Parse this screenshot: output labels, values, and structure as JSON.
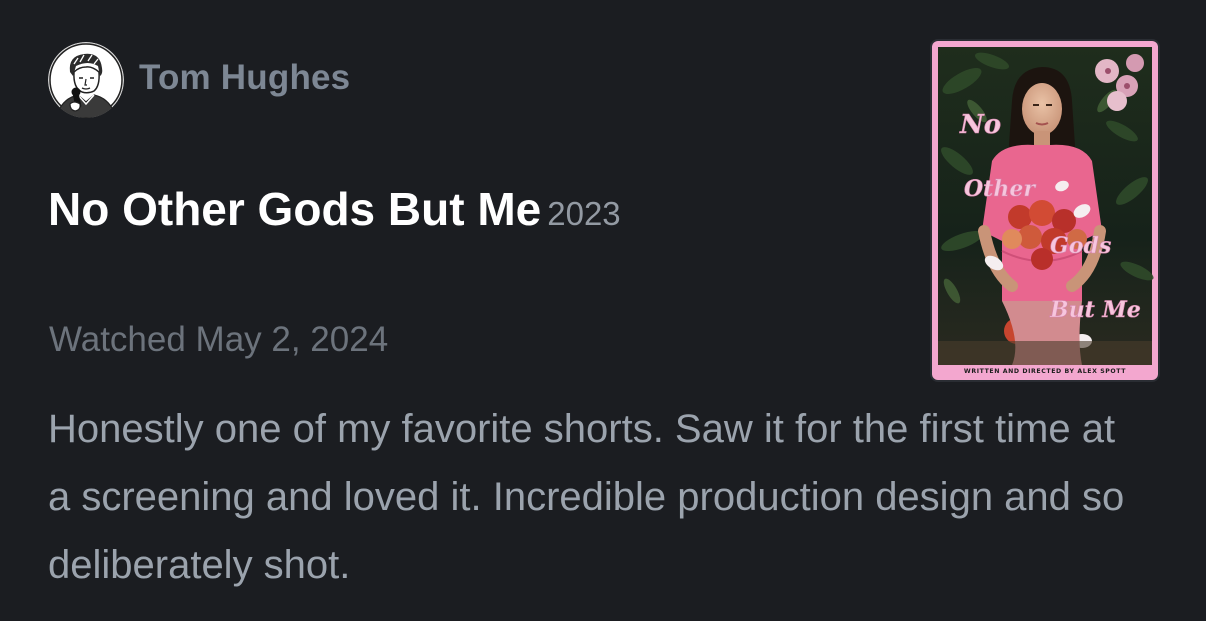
{
  "review": {
    "author": {
      "name": "Tom Hughes",
      "avatar_icon": "avatar-illustration-icon"
    },
    "film": {
      "title": "No Other Gods But Me",
      "year": "2023"
    },
    "watched_text": "Watched May 2, 2024",
    "body": "Honestly one of my favorite shorts. Saw it for the first time at a screening and loved it. Incredible production design and so deliberately shot.",
    "poster": {
      "title_words": [
        "No",
        "Other",
        "Gods",
        "But Me"
      ],
      "credit": "WRITTEN AND DIRECTED BY ALEX SPOTT"
    }
  },
  "colors": {
    "background": "#1b1d21",
    "author_name": "#7d8794",
    "title": "#ffffff",
    "year": "#939aa3",
    "watched": "#6c737c",
    "body_text": "#9ba3ad",
    "poster_border": "#f3a7cf"
  }
}
